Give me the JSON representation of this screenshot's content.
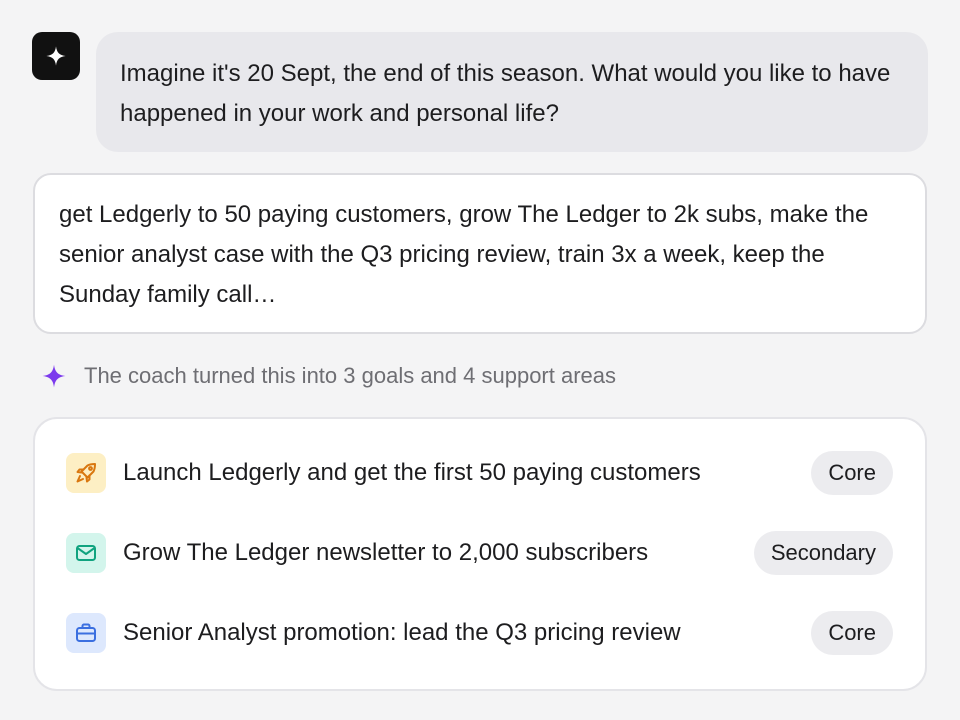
{
  "coach": {
    "avatar_icon": "sparkle-icon",
    "prompt": "Imagine it's 20 Sept, the end of this season. What would you like to have happened in your work and personal life?"
  },
  "answer": {
    "text": "get Ledgerly to 50 paying customers, grow The Ledger to 2k subs, make the senior analyst case with the Q3 pricing review, train 3x a week, keep the Sunday family call…"
  },
  "summary": {
    "icon": "sparkle-icon",
    "accent_color": "#7c3aed",
    "text": "The coach turned this into 3 goals and 4 support areas"
  },
  "goals": [
    {
      "label": "Launch Ledgerly and get the first 50 paying customers",
      "badge": "Core",
      "icon": "rocket-icon",
      "icon_bg": "#fdefc4",
      "icon_color": "#d9770f"
    },
    {
      "label": "Grow The Ledger newsletter to 2,000 subscribers",
      "badge": "Secondary",
      "icon": "mail-icon",
      "icon_bg": "#d3f5ec",
      "icon_color": "#10a37f"
    },
    {
      "label": "Senior Analyst promotion: lead the Q3 pricing review",
      "badge": "Core",
      "icon": "briefcase-icon",
      "icon_bg": "#dde8fd",
      "icon_color": "#3b6fe0"
    }
  ]
}
